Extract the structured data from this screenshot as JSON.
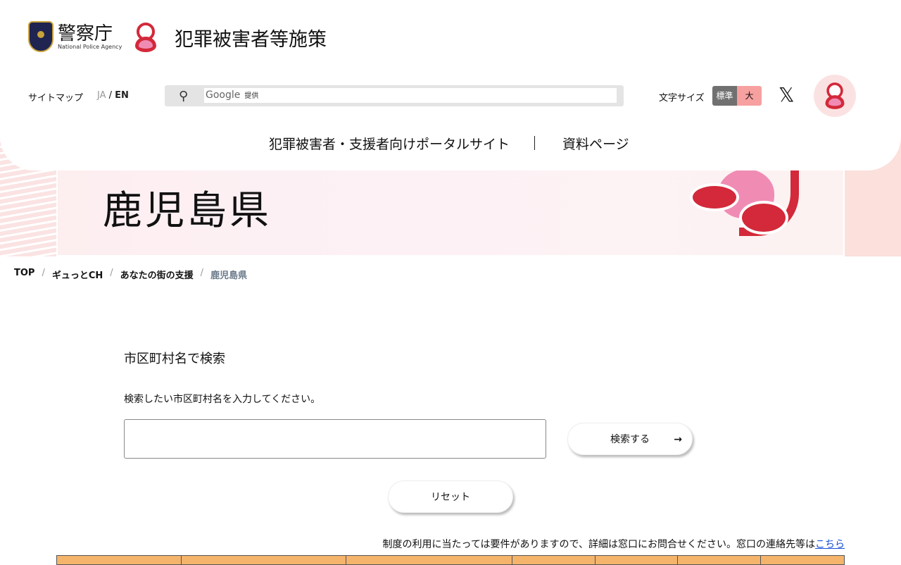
{
  "header": {
    "npa_title": "警察庁",
    "npa_subtitle": "National Police Agency",
    "site_title": "犯罪被害者等施策",
    "sitemap": "サイトマップ",
    "lang_ja": "JA",
    "lang_sep": "/",
    "lang_en": "EN",
    "search_provider": "Google",
    "search_provided": "提供",
    "font_size_label": "文字サイズ",
    "font_standard": "標準",
    "font_large": "大",
    "nav": [
      "犯罪被害者・支援者向けポータルサイト",
      "資料ページ"
    ]
  },
  "banner": {
    "title": "鹿児島県"
  },
  "breadcrumb": [
    "TOP",
    "ギュっとCH",
    "あなたの街の支援",
    "鹿児島県"
  ],
  "search_section": {
    "heading": "市区町村名で検索",
    "hint": "検索したい市区町村名を入力してください。",
    "input_value": "",
    "search_button": "検索する",
    "arrow": "→",
    "reset_button": "リセット"
  },
  "note": {
    "text": "制度の利用に当たっては要件がありますので、詳細は窓口にお問合せください。窓口の連絡先等は",
    "link": "こちら"
  },
  "colors": {
    "accent": "#d3293a",
    "table_header": "#f4b46c",
    "font_standard_bg": "#707070",
    "font_large_bg": "#f7a0a0"
  }
}
